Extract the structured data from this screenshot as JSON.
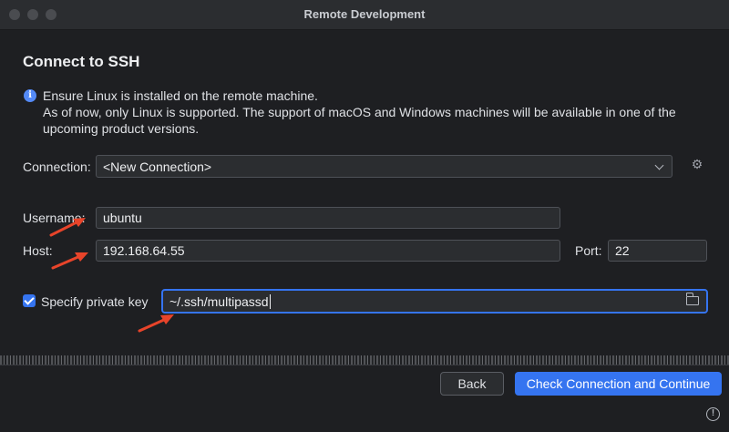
{
  "window": {
    "title": "Remote Development"
  },
  "dialog": {
    "heading": "Connect to SSH",
    "info_line1": "Ensure Linux is installed on the remote machine.",
    "info_line2": "As of now, only Linux is supported. The support of macOS and Windows machines will be available in one of the",
    "info_line3": "upcoming product versions."
  },
  "connection": {
    "label": "Connection:",
    "selected": "<New Connection>"
  },
  "username": {
    "label": "Username:",
    "value": "ubuntu"
  },
  "host": {
    "label": "Host:",
    "value": "192.168.64.55"
  },
  "port": {
    "label": "Port:",
    "value": "22"
  },
  "private_key": {
    "checkbox_label": "Specify private key",
    "checked": true,
    "path": "~/.ssh/multipassd"
  },
  "footer": {
    "back_label": "Back",
    "continue_label": "Check Connection and Continue"
  },
  "colors": {
    "accent": "#3574f0",
    "arrow": "#e8442a",
    "background": "#1e1f22"
  }
}
